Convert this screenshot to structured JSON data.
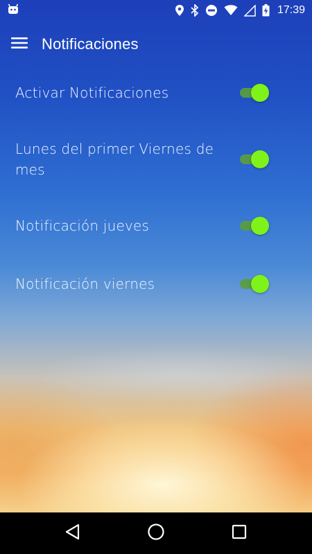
{
  "status_bar": {
    "time": "17:39",
    "icons": [
      "android-icon",
      "location-icon",
      "bluetooth-icon",
      "do-not-disturb-icon",
      "wifi-icon",
      "signal-icon",
      "battery-charging-icon"
    ]
  },
  "app_bar": {
    "title": "Notificaciones",
    "menu_icon": "hamburger-menu-icon"
  },
  "settings": [
    {
      "label": "Activar Notificaciones",
      "enabled": true
    },
    {
      "label": "Lunes del primer Viernes de mes",
      "enabled": true
    },
    {
      "label": "Notificación jueves",
      "enabled": true
    },
    {
      "label": "Notificación viernes",
      "enabled": true
    }
  ],
  "nav_bar": {
    "icons": [
      "back-icon",
      "home-icon",
      "recents-icon"
    ]
  },
  "colors": {
    "switch_thumb": "#7ff21a",
    "switch_track": "#5a9c43",
    "nav_bar": "#000000"
  }
}
